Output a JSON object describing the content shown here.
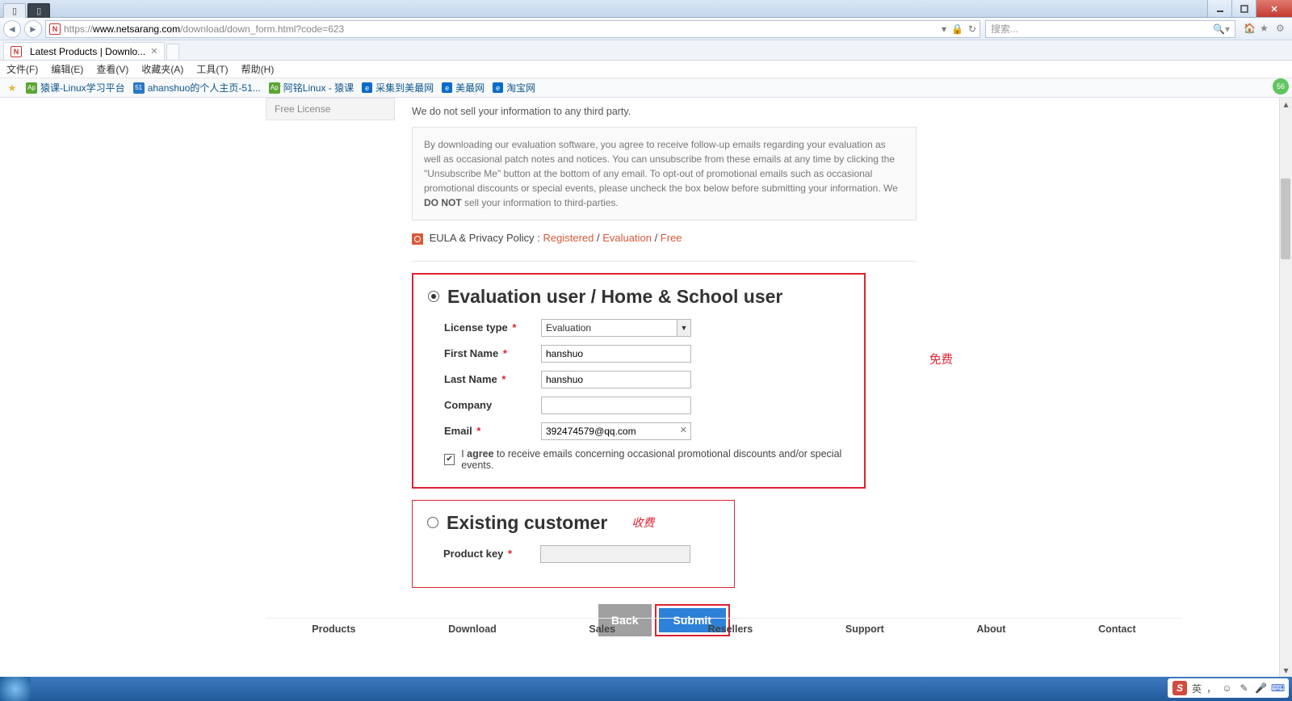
{
  "titlebar": {
    "tab1": "",
    "tab2": ""
  },
  "nav": {
    "url_proto": "https://",
    "url_host": "www.netsarang.com",
    "url_path": "/download/down_form.html?code=623",
    "search_placeholder": "搜索..."
  },
  "btab": {
    "title": "Latest Products | Downlo..."
  },
  "menu": {
    "file": "文件(F)",
    "edit": "编辑(E)",
    "view": "查看(V)",
    "fav": "收藏夹(A)",
    "tools": "工具(T)",
    "help": "帮助(H)"
  },
  "bookmarks": {
    "b1": "猿课-Linux学习平台",
    "b2": "ahanshuo的个人主页-51...",
    "b3": "阿铭Linux - 猿课",
    "b4": "采集到美最网",
    "b5": "美最网",
    "b6": "淘宝网",
    "badge": "56"
  },
  "sidebar": {
    "item": "Free License"
  },
  "content": {
    "notice": "We do not sell your information to any third party.",
    "info_pre": "By downloading our evaluation software, you agree to receive follow-up emails regarding your evaluation as well as occasional patch notes and notices. You can unsubscribe from these emails at any time by clicking the \"Unsubscribe Me\" button at the bottom of any email. To opt-out of promotional emails such as occasional promotional discounts or special events, please uncheck the box below before submitting your information. We ",
    "info_bold": "DO NOT",
    "info_post": " sell your information to third-parties.",
    "eula_label": "EULA & Privacy Policy : ",
    "eula_reg": "Registered",
    "eula_eval": "Evaluation",
    "eula_free": "Free",
    "slash": " / "
  },
  "form1": {
    "heading": "Evaluation user / Home & School user",
    "license_label": "License type",
    "license_val": "Evaluation",
    "fname_label": "First Name",
    "fname_val": "hanshuo",
    "lname_label": "Last Name",
    "lname_val": "hanshuo",
    "company_label": "Company",
    "company_val": "",
    "email_label": "Email",
    "email_val": "392474579@qq.com",
    "agree_pre": "I ",
    "agree_bold": "agree",
    "agree_post": " to receive emails concerning occasional promotional discounts and/or special events.",
    "free_annot": "免费"
  },
  "form2": {
    "heading": "Existing customer",
    "pkey_label": "Product key",
    "pay_annot": "收费"
  },
  "buttons": {
    "back": "Back",
    "submit": "Submit"
  },
  "footer": {
    "c1": "Products",
    "c2": "Download",
    "c3": "Sales",
    "c4": "Resellers",
    "c5": "Support",
    "c6": "About",
    "c7": "Contact"
  },
  "tray": {
    "lang": "英",
    "punct": "，",
    "sep": "·"
  }
}
